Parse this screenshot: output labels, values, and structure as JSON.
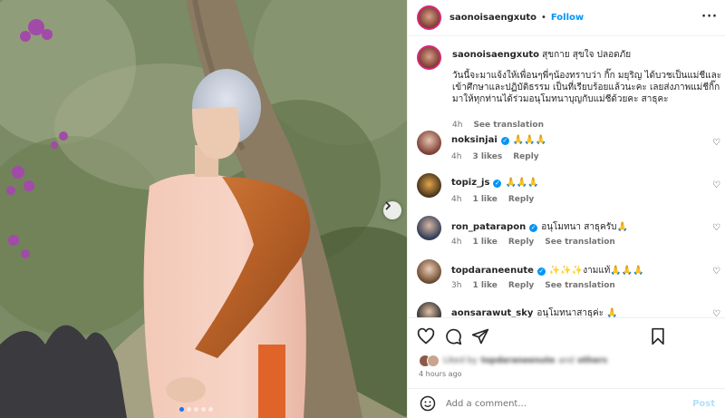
{
  "post": {
    "author": "saonoisaengxuto",
    "follow_label": "Follow",
    "separator": "•",
    "more_icon": "more-horizontal-icon"
  },
  "caption": {
    "username": "saonoisaengxuto",
    "headline": "สุขกาย สุขใจ ปลอดภัย",
    "body": "วันนี้จะมาแจ้งให้เพื่อนๆพี่ๆน้องทราบว่า กิ๊ก มยุริญ ได้บวชเป็นแม่ชีและเข้าศึกษาและปฏิบัติธรรม เป็นที่เรียบร้อยแล้วนะคะ เลยส่งภาพแม่ชีกิ๊กมาให้ทุกท่านได้ร่วมอนุโมทนาบุญกับแม่ชีด้วยคะ สาธุคะ",
    "time": "4h",
    "translate": "See translation"
  },
  "comments": [
    {
      "username": "noksinjai",
      "verified": true,
      "text": "🙏🙏🙏",
      "time": "4h",
      "likes": "3 likes",
      "reply": "Reply",
      "translate": ""
    },
    {
      "username": "topiz_js",
      "verified": true,
      "text": "🙏🙏🙏",
      "time": "4h",
      "likes": "1 like",
      "reply": "Reply",
      "translate": ""
    },
    {
      "username": "ron_patarapon",
      "verified": true,
      "text": "อนุโมทนา สาธุครับ🙏",
      "time": "4h",
      "likes": "1 like",
      "reply": "Reply",
      "translate": "See translation"
    },
    {
      "username": "topdaraneenute",
      "verified": true,
      "text": "✨✨✨งามแท้🙏🙏🙏",
      "time": "3h",
      "likes": "1 like",
      "reply": "Reply",
      "translate": "See translation"
    },
    {
      "username": "aonsarawut_sky",
      "verified": false,
      "text": "อนุโมทนาสาธุค่ะ 🙏",
      "time": "",
      "likes": "",
      "reply": "",
      "translate": ""
    }
  ],
  "actions": {
    "like_icon": "heart-icon",
    "comment_icon": "comment-icon",
    "share_icon": "send-icon",
    "save_icon": "bookmark-icon"
  },
  "likes": {
    "prefix": "Liked by",
    "user": "topdaraneenute",
    "connector": "and",
    "others": "others"
  },
  "timestamp": "4 hours ago",
  "add_comment": {
    "emoji_icon": "emoji-icon",
    "placeholder": "Add a comment...",
    "post_label": "Post"
  },
  "carousel": {
    "next_icon": "chevron-right-icon",
    "total": 5,
    "current": 1
  },
  "colors": {
    "accent": "#0095f6",
    "text": "#262626",
    "muted": "#737373",
    "border": "#efefef",
    "post_disabled": "#b2dffc"
  }
}
